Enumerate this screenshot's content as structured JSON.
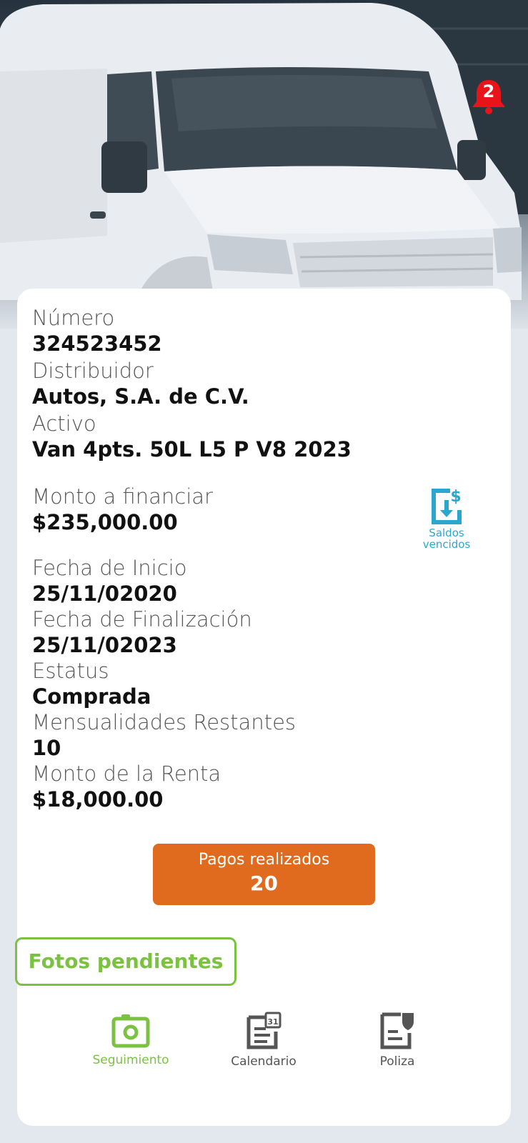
{
  "notifications": {
    "count": "2",
    "icon": "bell-icon",
    "color": "#e8141a"
  },
  "fields": {
    "numero": {
      "label": "Número",
      "value": "324523452"
    },
    "distribuidor": {
      "label": "Distribuidor",
      "value": "Autos, S.A. de C.V."
    },
    "activo": {
      "label": "Activo",
      "value": "Van 4pts. 50L L5 P V8 2023"
    },
    "monto_financiar": {
      "label": "Monto a financiar",
      "value": "$235,000.00"
    },
    "fecha_inicio": {
      "label": "Fecha de Inicio",
      "value": "25/11/02020"
    },
    "fecha_fin": {
      "label": "Fecha de Finalización",
      "value": "25/11/02023"
    },
    "estatus": {
      "label": "Estatus",
      "value": "Comprada"
    },
    "mensualidades": {
      "label": "Mensualidades Restantes",
      "value": "10"
    },
    "monto_renta": {
      "label": "Monto de la Renta",
      "value": "$18,000.00"
    }
  },
  "saldos": {
    "line1": "Saldos",
    "line2": "vencidos",
    "icon": "download-dollar-document-icon",
    "color": "#2aa7cf"
  },
  "pagos": {
    "label": "Pagos realizados",
    "count": "20",
    "color": "#e06a1e"
  },
  "tooltip": {
    "text": "Fotos pendientes",
    "color": "#7cc242"
  },
  "nav": {
    "items": [
      {
        "label": "Seguimiento",
        "icon": "camera-icon",
        "active": true,
        "color": "#7cc242"
      },
      {
        "label": "Calendario",
        "icon": "calendar-document-icon",
        "active": false,
        "color": "#555555"
      },
      {
        "label": "Poliza",
        "icon": "shield-document-icon",
        "active": false,
        "color": "#555555"
      }
    ]
  }
}
